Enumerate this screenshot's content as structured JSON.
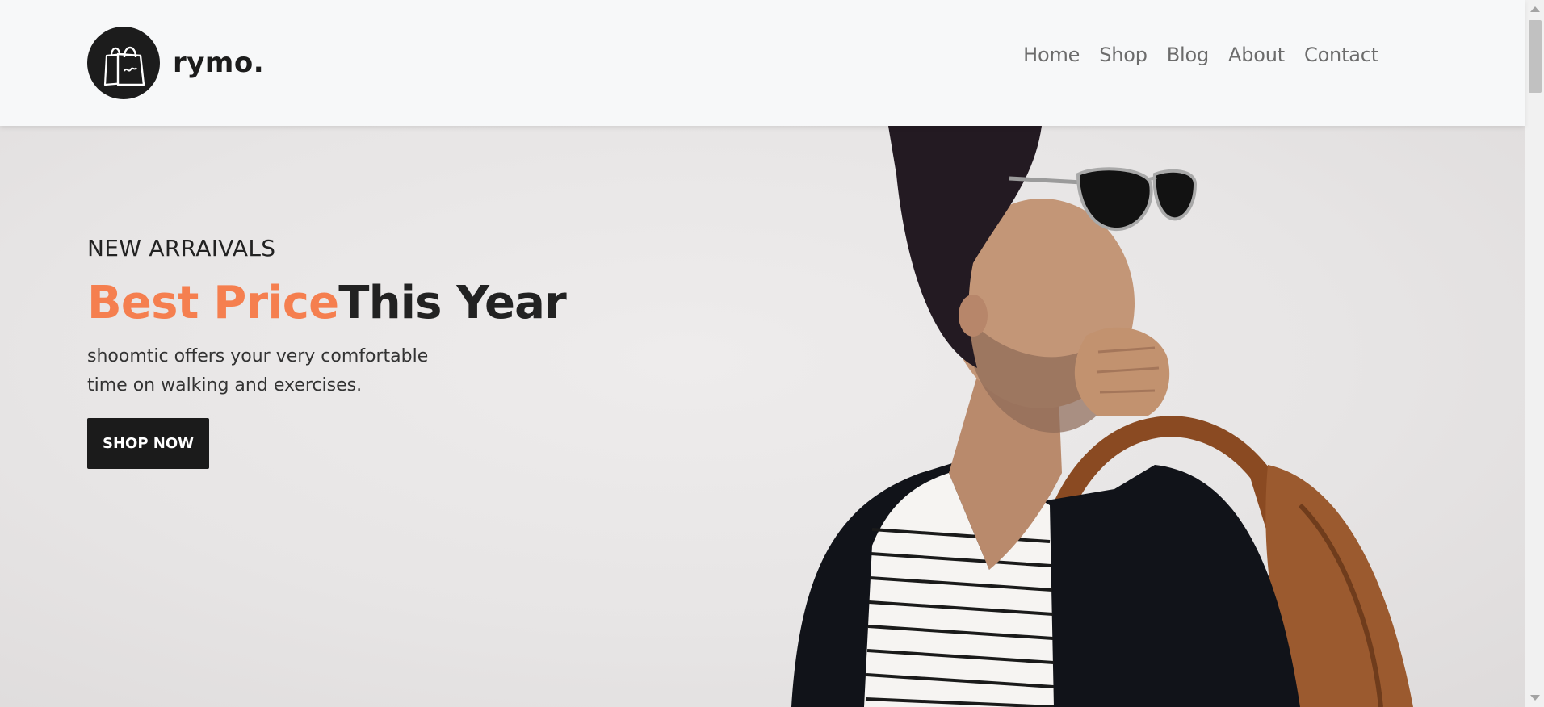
{
  "brand": {
    "name": "rymo."
  },
  "nav": {
    "items": [
      {
        "label": "Home"
      },
      {
        "label": "Shop"
      },
      {
        "label": "Blog"
      },
      {
        "label": "About"
      },
      {
        "label": "Contact"
      }
    ]
  },
  "hero": {
    "eyebrow": "NEW ARRAIVALS",
    "headline_accent": "Best Price",
    "headline_rest": "This Year",
    "description": "shoomtic offers your very comfortable time on walking and exercises.",
    "cta_label": "SHOP NOW"
  },
  "colors": {
    "accent": "#f57f4f",
    "dark": "#1b1b1b",
    "header_bg": "#f7f8f9"
  },
  "icons": {
    "logo": "shopping-bag-icon"
  }
}
